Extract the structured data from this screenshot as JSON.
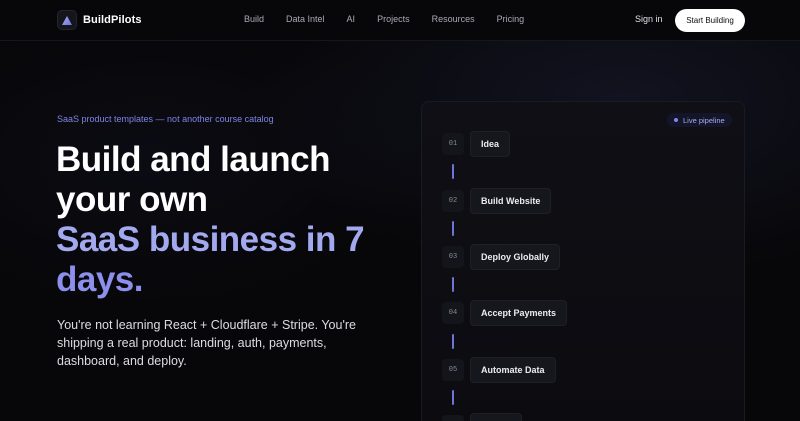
{
  "nav": {
    "brand": "BuildPilots",
    "links": [
      "Build",
      "Data Intel",
      "AI",
      "Projects",
      "Resources",
      "Pricing"
    ],
    "signin": "Sign in",
    "cta": "Start Building"
  },
  "hero": {
    "eyebrow": "SaaS product templates — not another course catalog",
    "headline_line1": "Build and launch",
    "headline_line2": "your own",
    "headline_line3a": "SaaS",
    "headline_line3b": "business in 7",
    "headline_line4": "days.",
    "subtext": "You're not learning React + Cloudflare + Stripe. You're shipping a real product: landing, auth, payments, dashboard, and deploy."
  },
  "pipeline": {
    "badge": "Live pipeline",
    "steps": [
      {
        "num": "01",
        "label": "Idea"
      },
      {
        "num": "02",
        "label": "Build Website"
      },
      {
        "num": "03",
        "label": "Deploy Globally"
      },
      {
        "num": "04",
        "label": "Accept Payments"
      },
      {
        "num": "05",
        "label": "Automate Data"
      }
    ]
  },
  "colors": {
    "accent": "#7d85e6",
    "background": "#070709",
    "cta_bg": "#ffffff"
  },
  "icons": {
    "logo": "triangle-logo-icon"
  }
}
